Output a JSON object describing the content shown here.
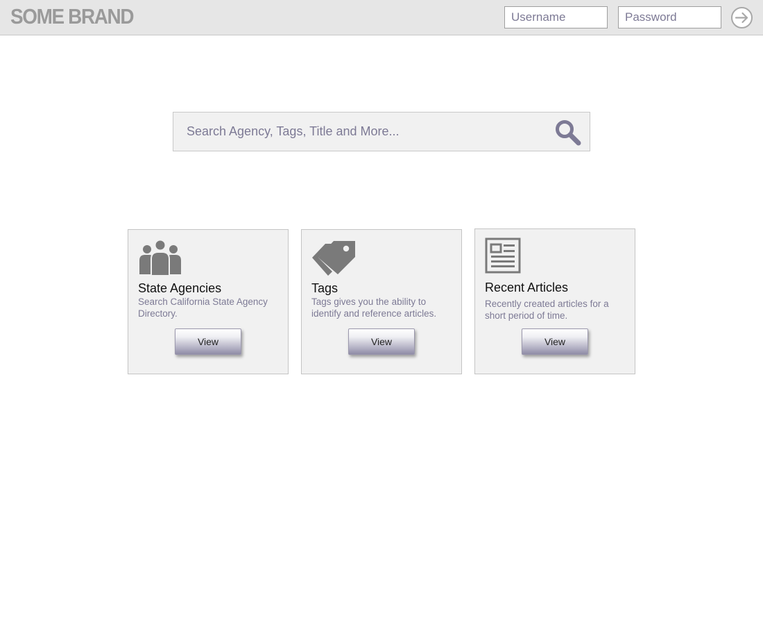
{
  "header": {
    "brand": "SOME BRAND",
    "username_placeholder": "Username",
    "password_placeholder": "Password",
    "username_value": "",
    "password_value": "",
    "submit_icon": "arrow-right-circle-icon"
  },
  "search": {
    "placeholder": "Search Agency, Tags, Title and More...",
    "value": "",
    "icon": "search-icon"
  },
  "cards": [
    {
      "icon": "people-group-icon",
      "title": "State Agencies",
      "description": "Search California State Agency Directory.",
      "button_label": "View"
    },
    {
      "icon": "tags-icon",
      "title": "Tags",
      "description": "Tags gives you the ability to identify and reference articles.",
      "button_label": "View"
    },
    {
      "icon": "newspaper-icon",
      "title": "Recent Articles",
      "description": "Recently created articles for a short period of time.",
      "button_label": "View"
    }
  ],
  "colors": {
    "header_bg": "#e6e6e6",
    "brand_text": "#9a9a9a",
    "accent_purple": "#7d7a95",
    "card_bg": "#f1f1f1",
    "icon_gray": "#7a7a7a"
  }
}
